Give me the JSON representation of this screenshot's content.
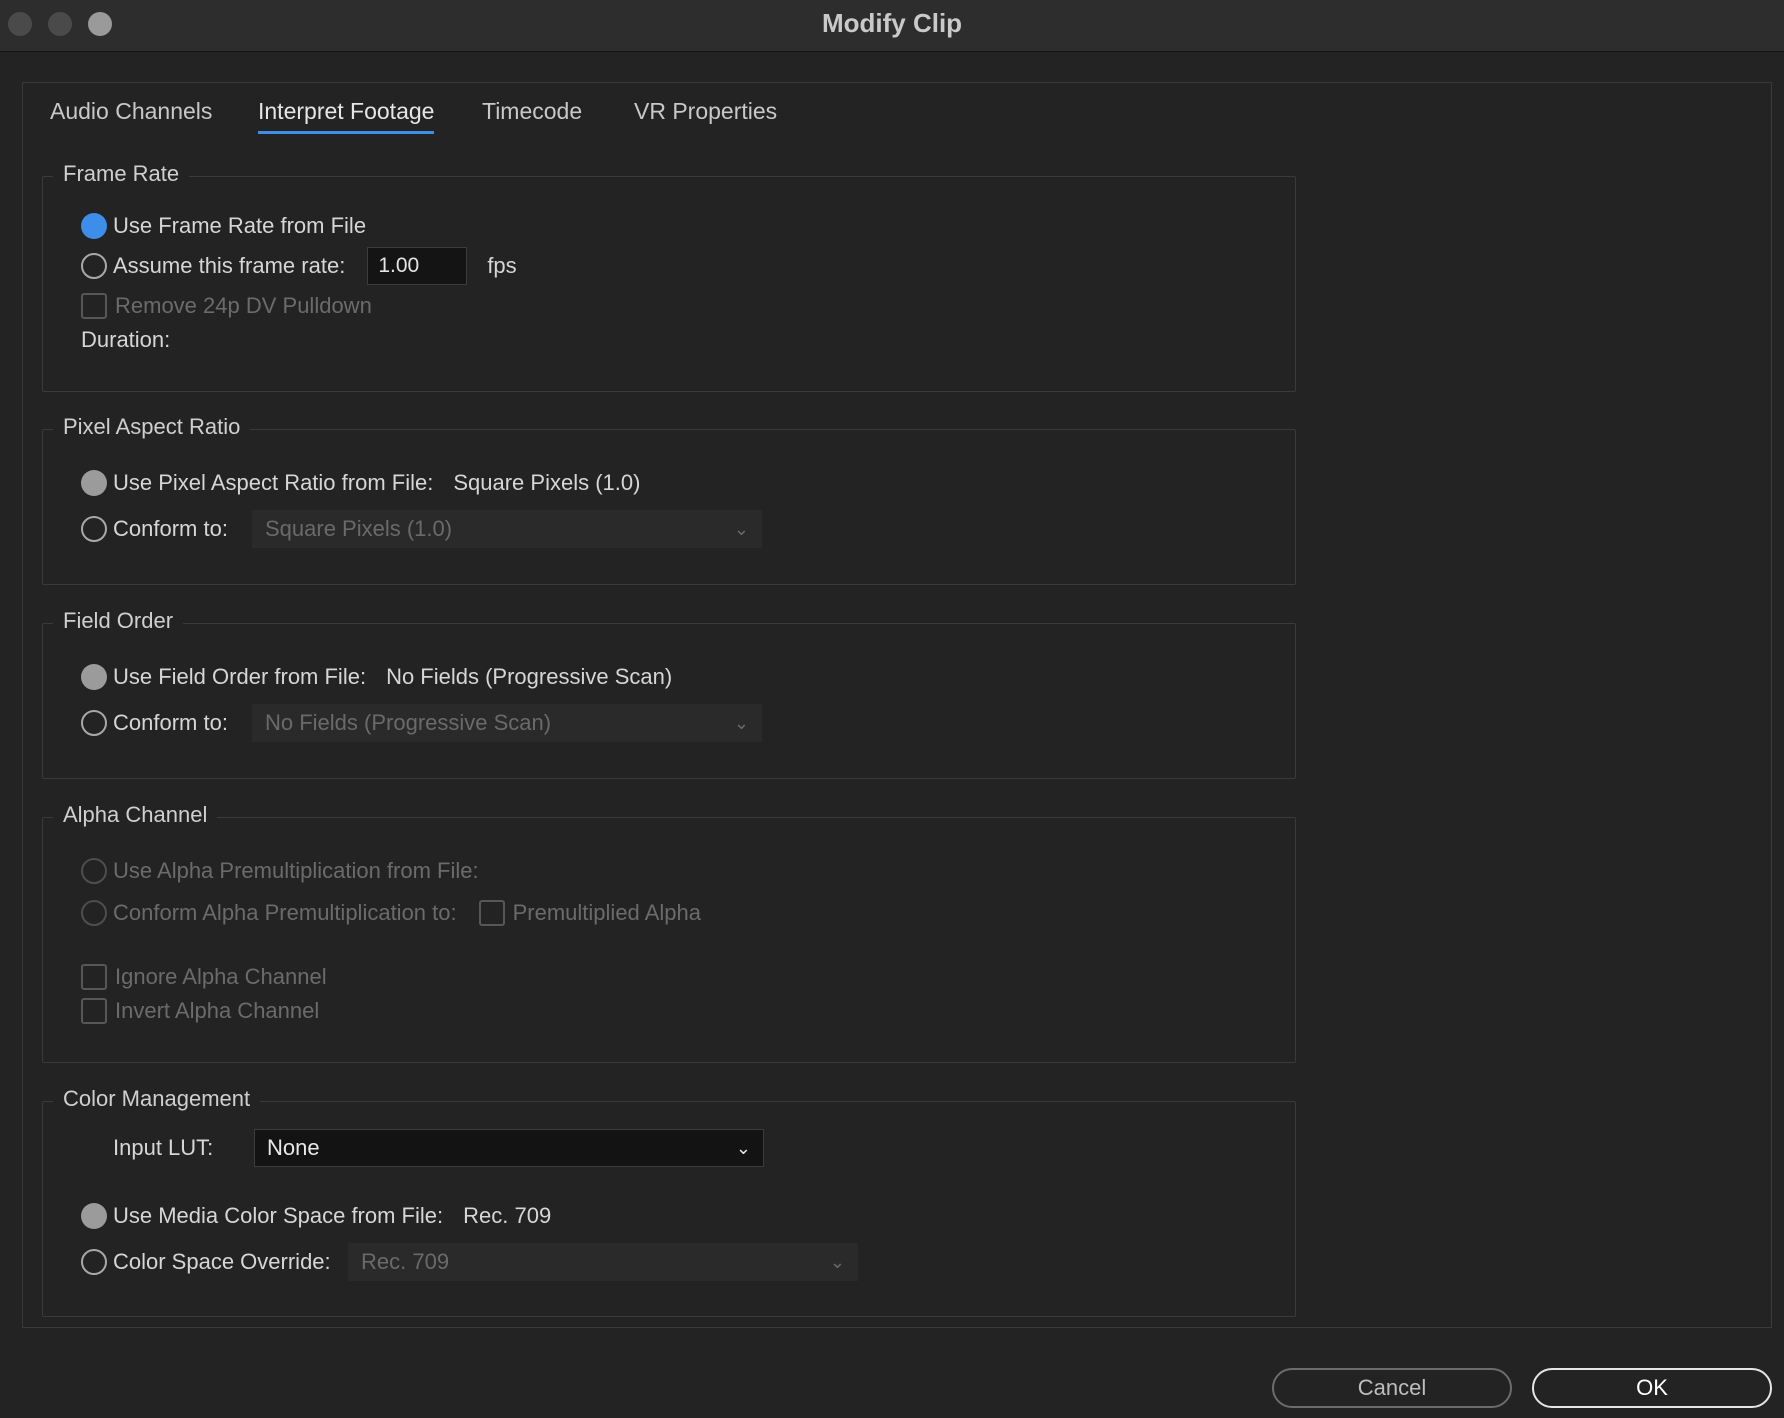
{
  "window": {
    "title": "Modify Clip"
  },
  "tabs": [
    {
      "label": "Audio Channels"
    },
    {
      "label": "Interpret Footage"
    },
    {
      "label": "Timecode"
    },
    {
      "label": "VR Properties"
    }
  ],
  "active_tab": "Interpret Footage",
  "frame_rate": {
    "legend": "Frame Rate",
    "use_from_file_label": "Use Frame Rate from File",
    "assume_label": "Assume this frame rate:",
    "assume_value": "1.00",
    "fps_label": "fps",
    "remove_pulldown_label": "Remove 24p DV Pulldown",
    "duration_label": "Duration:"
  },
  "pixel_aspect": {
    "legend": "Pixel Aspect Ratio",
    "use_from_file_label": "Use Pixel Aspect Ratio from File:",
    "use_from_file_value": "Square Pixels (1.0)",
    "conform_label": "Conform to:",
    "conform_value": "Square Pixels (1.0)"
  },
  "field_order": {
    "legend": "Field Order",
    "use_from_file_label": "Use Field Order from File:",
    "use_from_file_value": "No Fields (Progressive Scan)",
    "conform_label": "Conform to:",
    "conform_value": "No Fields (Progressive Scan)"
  },
  "alpha_channel": {
    "legend": "Alpha Channel",
    "use_premult_label": "Use Alpha Premultiplication from File:",
    "conform_premult_label": "Conform Alpha Premultiplication to:",
    "premultiplied_label": "Premultiplied Alpha",
    "ignore_label": "Ignore Alpha Channel",
    "invert_label": "Invert Alpha Channel"
  },
  "color_management": {
    "legend": "Color Management",
    "input_lut_label": "Input LUT:",
    "input_lut_value": "None",
    "use_media_label": "Use Media Color Space from File:",
    "use_media_value": "Rec. 709",
    "override_label": "Color Space Override:",
    "override_value": "Rec. 709"
  },
  "buttons": {
    "cancel": "Cancel",
    "ok": "OK"
  },
  "colors": {
    "accent": "#3d8ee8",
    "background": "#232323",
    "titlebar": "#2d2d2d"
  }
}
